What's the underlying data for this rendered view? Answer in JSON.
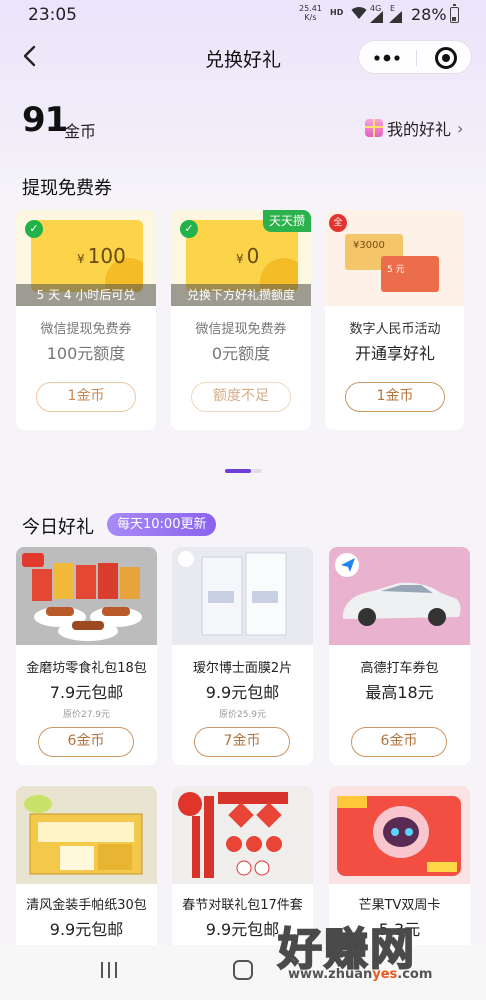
{
  "status_bar": {
    "time": "23:05",
    "speed_value": "25.41",
    "speed_unit": "K/s",
    "hd": "HD",
    "network": "4G",
    "network2": "E",
    "battery": "28%"
  },
  "nav": {
    "title": "兑换好礼"
  },
  "coins": {
    "balance": "91",
    "unit": "金币",
    "my_gifts_label": "我的好礼"
  },
  "withdraw_section": {
    "title": "提现免费券",
    "cards": [
      {
        "amount": "100",
        "currency": "¥",
        "overlay": "5 天 4 小时后可兑",
        "subtitle": "微信提现免费券",
        "main": "100元额度",
        "button": "1金币"
      },
      {
        "amount": "0",
        "currency": "¥",
        "tag": "天天攒",
        "overlay": "兑换下方好礼攒额度",
        "subtitle": "微信提现免费券",
        "main": "0元额度",
        "button": "额度不足"
      },
      {
        "bill1": "¥3000",
        "bill2": "5 元",
        "icon": "全",
        "subtitle": "数字人民币活动",
        "main": "开通享好礼",
        "button": "1金币"
      }
    ]
  },
  "today_section": {
    "title": "今日好礼",
    "badge": "每天10:00更新",
    "products": [
      {
        "name": "金磨坊零食礼包18包",
        "price": "7.9元包邮",
        "original": "原价27.9元",
        "button": "6金币"
      },
      {
        "name": "瑷尔博士面膜2片",
        "price": "9.9元包邮",
        "original": "原价25.9元",
        "button": "7金币"
      },
      {
        "name": "高德打车券包",
        "price": "最高18元",
        "button": "6金币"
      },
      {
        "name": "清风金装手帕纸30包",
        "price": "9.9元包邮"
      },
      {
        "name": "春节对联礼包17件套",
        "price": "9.9元包邮"
      },
      {
        "name": "芒果TV双周卡",
        "price": "5.3元"
      }
    ]
  },
  "watermark": {
    "main": "好赚网",
    "url_pre": "www.zhuan",
    "url_hl": "yes",
    "url_post": ".com"
  },
  "colors": {
    "accent_purple": "#6e3ed8",
    "coin_gold": "#c78a50",
    "wechat_green": "#21b24a"
  }
}
